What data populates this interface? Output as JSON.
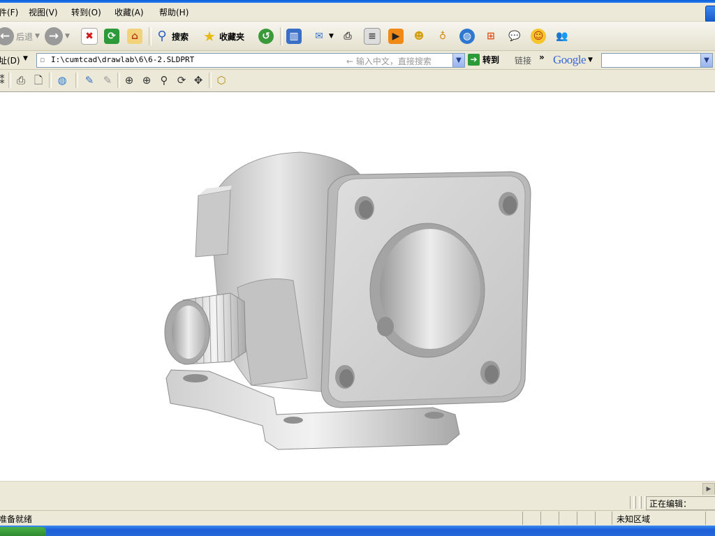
{
  "menu": {
    "file": "件(F)",
    "view": "视图(V)",
    "goto": "转到(O)",
    "favorites": "收藏(A)",
    "help": "帮助(H)"
  },
  "toolbar": {
    "back_label": "后退",
    "search_label": "搜索",
    "favorites_label": "收藏夹"
  },
  "address": {
    "label": "址(D)",
    "url": "I:\\cumtcad\\drawlab\\6\\6-2.SLDPRT",
    "hint": "← 输入中文，直接搜索",
    "go_label": "转到",
    "links_label": "链接",
    "more": "»",
    "google_label": "Google",
    "google_value": ""
  },
  "editbar": {
    "label": "正在编辑："
  },
  "status": {
    "left_text": "准备就绪",
    "zone_text": "未知区域"
  },
  "colors": {
    "xp_blue": "#1c5fd8",
    "chrome": "#ece9d8",
    "part_gray": "#c8c8c8"
  },
  "icons": {
    "back": "back-arrow-icon",
    "forward": "forward-arrow-icon",
    "stop": "stop-icon",
    "refresh": "refresh-icon",
    "home": "home-icon",
    "search": "search-icon",
    "favorites": "star-icon",
    "history": "history-icon"
  }
}
